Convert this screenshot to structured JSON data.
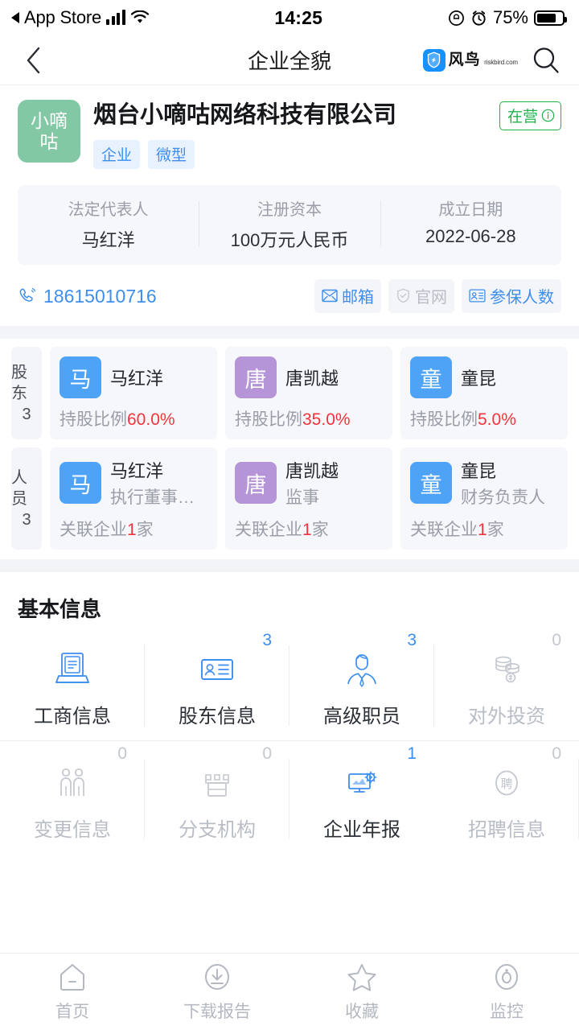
{
  "status_bar": {
    "carrier_back_label": "App Store",
    "time": "14:25",
    "battery_percent": "75%",
    "icons": [
      "back-triangle-icon",
      "signal-icon",
      "wifi-icon",
      "rotation-lock-icon",
      "alarm-icon",
      "battery-icon"
    ]
  },
  "nav": {
    "back_icon": "chevron-left-icon",
    "title": "企业全貌",
    "brand_name": "风鸟",
    "brand_domain": "riskbird.com",
    "search_icon": "search-icon"
  },
  "company": {
    "logo_text": "小嘀咕",
    "logo_color": "#82c8a5",
    "name": "烟台小嘀咕网络科技有限公司",
    "status": "在营",
    "status_color": "#1fb14a",
    "tags": [
      "企业",
      "微型"
    ],
    "key_info": [
      {
        "label": "法定代表人",
        "value": "马红洋"
      },
      {
        "label": "注册资本",
        "value": "100万元人民币"
      },
      {
        "label": "成立日期",
        "value": "2022-06-28"
      }
    ],
    "phone": "18615010716",
    "chips": [
      {
        "label": "邮箱",
        "icon": "envelope-icon",
        "enabled": true
      },
      {
        "label": "官网",
        "icon": "shield-check-icon",
        "enabled": false
      },
      {
        "label": "参保人数",
        "icon": "id-card-icon",
        "enabled": true
      }
    ]
  },
  "shareholders": {
    "label_line1": "股东",
    "label_line2": "3",
    "items": [
      {
        "initial": "马",
        "name": "马红洋",
        "color": "#4fa3f7",
        "ratio_label": "持股比例",
        "ratio": "60.0%"
      },
      {
        "initial": "唐",
        "name": "唐凯越",
        "color": "#b694d8",
        "ratio_label": "持股比例",
        "ratio": "35.0%"
      },
      {
        "initial": "童",
        "name": "童昆",
        "color": "#4fa3f7",
        "ratio_label": "持股比例",
        "ratio": "5.0%"
      }
    ]
  },
  "personnel": {
    "label_line1": "人员",
    "label_line2": "3",
    "items": [
      {
        "initial": "马",
        "name": "马红洋",
        "color": "#4fa3f7",
        "title": "执行董事…",
        "rel_prefix": "关联企业",
        "rel_count": "1",
        "rel_suffix": "家"
      },
      {
        "initial": "唐",
        "name": "唐凯越",
        "color": "#b694d8",
        "title": "监事",
        "rel_prefix": "关联企业",
        "rel_count": "1",
        "rel_suffix": "家"
      },
      {
        "initial": "童",
        "name": "童昆",
        "color": "#4fa3f7",
        "title": "财务负责人",
        "rel_prefix": "关联企业",
        "rel_count": "1",
        "rel_suffix": "家"
      }
    ]
  },
  "basic_info": {
    "title": "基本信息",
    "row1": [
      {
        "label": "工商信息",
        "badge": "",
        "icon": "business-license-icon",
        "active": true
      },
      {
        "label": "股东信息",
        "badge": "3",
        "icon": "id-card-icon",
        "active": true
      },
      {
        "label": "高级职员",
        "badge": "3",
        "icon": "executive-icon",
        "active": true
      },
      {
        "label": "对外投资",
        "badge": "0",
        "icon": "coins-icon",
        "active": false
      }
    ],
    "row2": [
      {
        "label": "变更信息",
        "badge": "0",
        "icon": "people-change-icon",
        "active": false
      },
      {
        "label": "分支机构",
        "badge": "0",
        "icon": "branch-building-icon",
        "active": false
      },
      {
        "label": "企业年报",
        "badge": "1",
        "icon": "monitor-gear-icon",
        "active": true
      },
      {
        "label": "招聘信息",
        "badge": "0",
        "icon": "recruit-icon",
        "active": false
      }
    ]
  },
  "tabbar": [
    {
      "label": "首页",
      "icon": "home-icon"
    },
    {
      "label": "下载报告",
      "icon": "download-icon"
    },
    {
      "label": "收藏",
      "icon": "star-icon"
    },
    {
      "label": "监控",
      "icon": "monitor-eye-icon"
    }
  ]
}
